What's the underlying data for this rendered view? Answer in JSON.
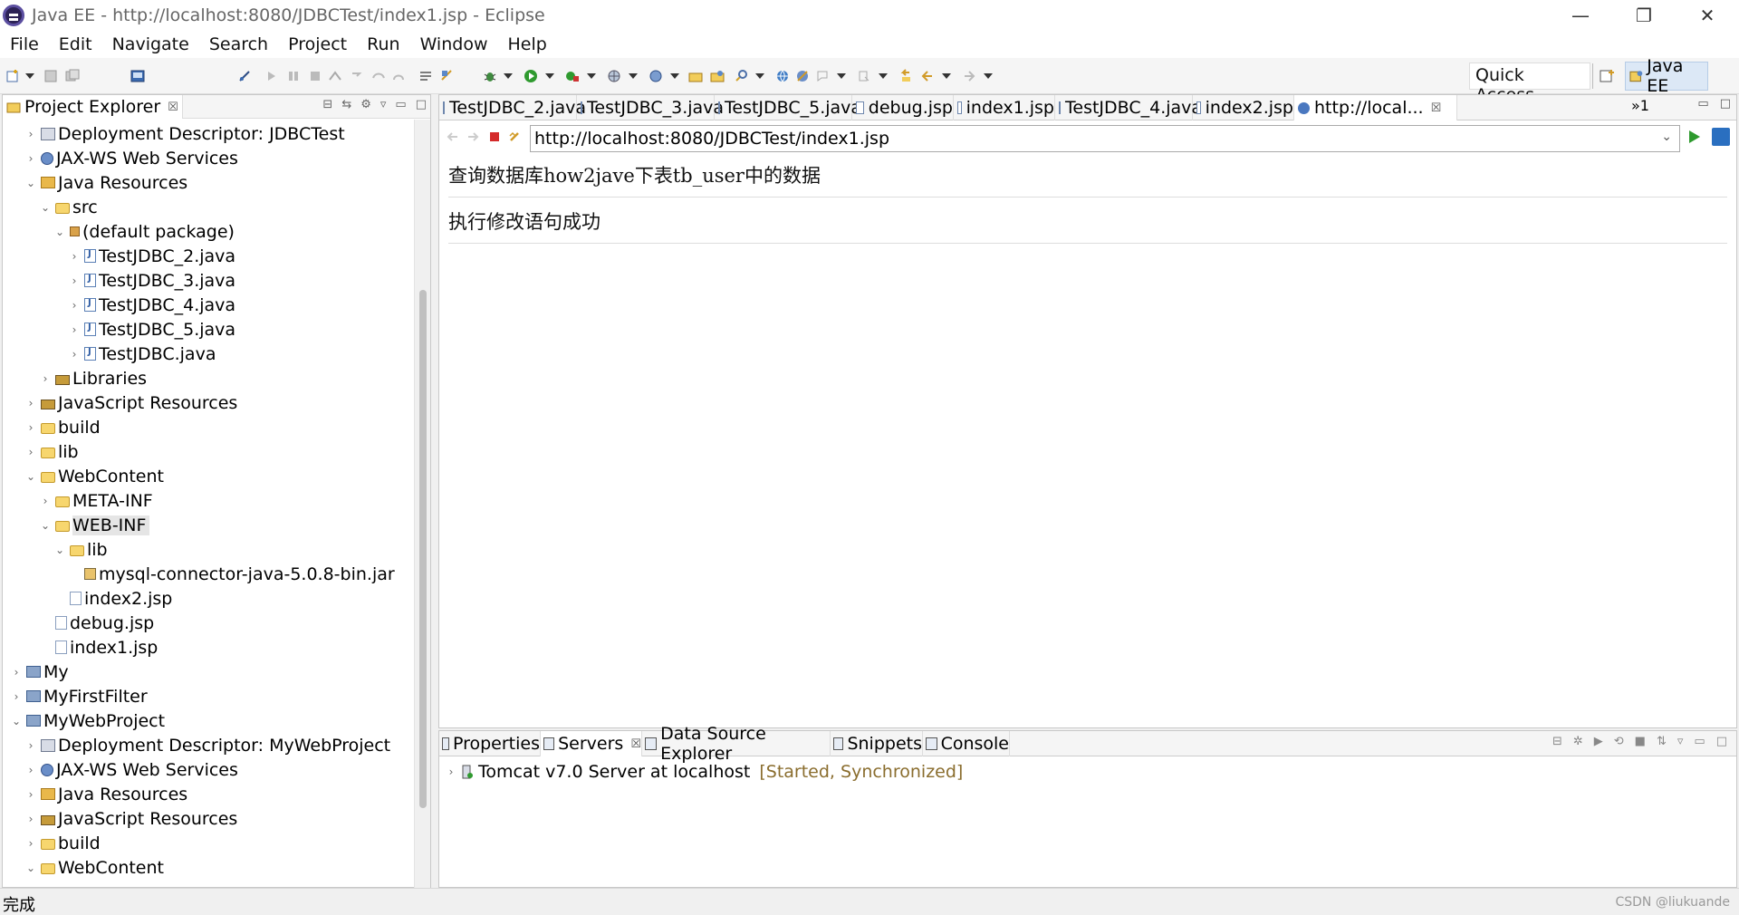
{
  "window": {
    "title": "Java EE - http://localhost:8080/JDBCTest/index1.jsp - Eclipse",
    "minimize": "—",
    "restore": "❐",
    "close": "✕"
  },
  "menu": [
    "File",
    "Edit",
    "Navigate",
    "Search",
    "Project",
    "Run",
    "Window",
    "Help"
  ],
  "toolbar": {
    "quick_access": "Quick Access",
    "perspective": "Java EE"
  },
  "explorer": {
    "tab_label": "Project Explorer",
    "tab_close": "☒",
    "tree": [
      {
        "label": "Deployment Descriptor: JDBCTest",
        "depth": 1,
        "twisty": "›",
        "icon": "dd"
      },
      {
        "label": "JAX-WS Web Services",
        "depth": 1,
        "twisty": "›",
        "icon": "globe"
      },
      {
        "label": "Java Resources",
        "depth": 1,
        "twisty": "⌄",
        "icon": "pkgres"
      },
      {
        "label": "src",
        "depth": 2,
        "twisty": "⌄",
        "icon": "folder"
      },
      {
        "label": "(default package)",
        "depth": 3,
        "twisty": "⌄",
        "icon": "pkg"
      },
      {
        "label": "TestJDBC_2.java",
        "depth": 4,
        "twisty": "›",
        "icon": "java"
      },
      {
        "label": "TestJDBC_3.java",
        "depth": 4,
        "twisty": "›",
        "icon": "java"
      },
      {
        "label": "TestJDBC_4.java",
        "depth": 4,
        "twisty": "›",
        "icon": "java"
      },
      {
        "label": "TestJDBC_5.java",
        "depth": 4,
        "twisty": "›",
        "icon": "java"
      },
      {
        "label": "TestJDBC.java",
        "depth": 4,
        "twisty": "›",
        "icon": "java"
      },
      {
        "label": "Libraries",
        "depth": 2,
        "twisty": "›",
        "icon": "lib"
      },
      {
        "label": "JavaScript Resources",
        "depth": 1,
        "twisty": "›",
        "icon": "lib"
      },
      {
        "label": "build",
        "depth": 1,
        "twisty": "›",
        "icon": "folder"
      },
      {
        "label": "lib",
        "depth": 1,
        "twisty": "›",
        "icon": "folder"
      },
      {
        "label": "WebContent",
        "depth": 1,
        "twisty": "⌄",
        "icon": "folder"
      },
      {
        "label": "META-INF",
        "depth": 2,
        "twisty": "›",
        "icon": "folder"
      },
      {
        "label": "WEB-INF",
        "depth": 2,
        "twisty": "⌄",
        "icon": "folder",
        "selected": true
      },
      {
        "label": "lib",
        "depth": 3,
        "twisty": "⌄",
        "icon": "folder"
      },
      {
        "label": "mysql-connector-java-5.0.8-bin.jar",
        "depth": 4,
        "twisty": "",
        "icon": "jar"
      },
      {
        "label": "index2.jsp",
        "depth": 3,
        "twisty": "",
        "icon": "jsp"
      },
      {
        "label": "debug.jsp",
        "depth": 2,
        "twisty": "",
        "icon": "jsp"
      },
      {
        "label": "index1.jsp",
        "depth": 2,
        "twisty": "",
        "icon": "jsp"
      },
      {
        "label": "My",
        "depth": 0,
        "twisty": "›",
        "icon": "proj"
      },
      {
        "label": "MyFirstFilter",
        "depth": 0,
        "twisty": "›",
        "icon": "proj"
      },
      {
        "label": "MyWebProject",
        "depth": 0,
        "twisty": "⌄",
        "icon": "proj"
      },
      {
        "label": "Deployment Descriptor: MyWebProject",
        "depth": 1,
        "twisty": "›",
        "icon": "dd"
      },
      {
        "label": "JAX-WS Web Services",
        "depth": 1,
        "twisty": "›",
        "icon": "globe"
      },
      {
        "label": "Java Resources",
        "depth": 1,
        "twisty": "›",
        "icon": "pkgres"
      },
      {
        "label": "JavaScript Resources",
        "depth": 1,
        "twisty": "›",
        "icon": "lib"
      },
      {
        "label": "build",
        "depth": 1,
        "twisty": "›",
        "icon": "folder"
      },
      {
        "label": "WebContent",
        "depth": 1,
        "twisty": "⌄",
        "icon": "folder"
      }
    ]
  },
  "editor": {
    "tabs": [
      {
        "label": "TestJDBC_2.java",
        "icon": "java-file-icon"
      },
      {
        "label": "TestJDBC_3.java",
        "icon": "java-file-icon"
      },
      {
        "label": "TestJDBC_5.java",
        "icon": "java-file-icon"
      },
      {
        "label": "debug.jsp",
        "icon": "jsp-file-icon"
      },
      {
        "label": "index1.jsp",
        "icon": "jsp-file-icon"
      },
      {
        "label": "TestJDBC_4.java",
        "icon": "java-file-icon"
      },
      {
        "label": "index2.jsp",
        "icon": "jsp-file-icon"
      },
      {
        "label": "http://local...",
        "icon": "globe-icon",
        "active": true,
        "close": "☒"
      }
    ],
    "overflow_label": "»1",
    "url": "http://localhost:8080/JDBCTest/index1.jsp",
    "content": {
      "line1": "查询数据库how2jave下表tb_user中的数据",
      "line2": "执行修改语句成功"
    }
  },
  "bottom_panel": {
    "tabs": [
      {
        "label": "Properties"
      },
      {
        "label": "Servers",
        "active": true,
        "close": "☒"
      },
      {
        "label": "Data Source Explorer"
      },
      {
        "label": "Snippets"
      },
      {
        "label": "Console"
      }
    ],
    "server": {
      "name": "Tomcat v7.0 Server at localhost",
      "state": "[Started, Synchronized]"
    }
  },
  "status": {
    "text": "完成",
    "watermark": "CSDN @liukuande"
  }
}
